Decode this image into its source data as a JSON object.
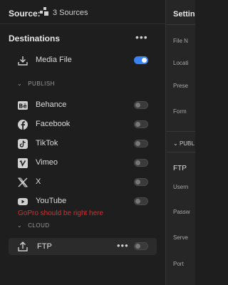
{
  "source": {
    "label": "Source:",
    "count": "3 Sources"
  },
  "destinations": {
    "title": "Destinations",
    "menu": "•••",
    "media_file": {
      "label": "Media File",
      "enabled": true
    },
    "publish_section": "PUBLISH",
    "publish_items": [
      {
        "label": "Behance",
        "icon": "behance-icon",
        "enabled": false
      },
      {
        "label": "Facebook",
        "icon": "facebook-icon",
        "enabled": false
      },
      {
        "label": "TikTok",
        "icon": "tiktok-icon",
        "enabled": false
      },
      {
        "label": "Vimeo",
        "icon": "vimeo-icon",
        "enabled": false
      },
      {
        "label": "X",
        "icon": "x-icon",
        "enabled": false
      },
      {
        "label": "YouTube",
        "icon": "youtube-icon",
        "enabled": false
      }
    ],
    "annotation": "GoPro should be right here",
    "cloud_section": "CLOUD",
    "ftp": {
      "label": "FTP",
      "menu": "•••",
      "enabled": false
    }
  },
  "right_panel": {
    "heading": "Setting",
    "labels": [
      "File N",
      "Locati",
      "Prese",
      "Form"
    ],
    "publish_header": "PUBL",
    "ftp_title": "FTP",
    "ftp_labels": [
      "Usern",
      "Passw",
      "Serve",
      "Port"
    ]
  },
  "colors": {
    "accent": "#3b82f6",
    "annotation": "#e02a2a"
  }
}
